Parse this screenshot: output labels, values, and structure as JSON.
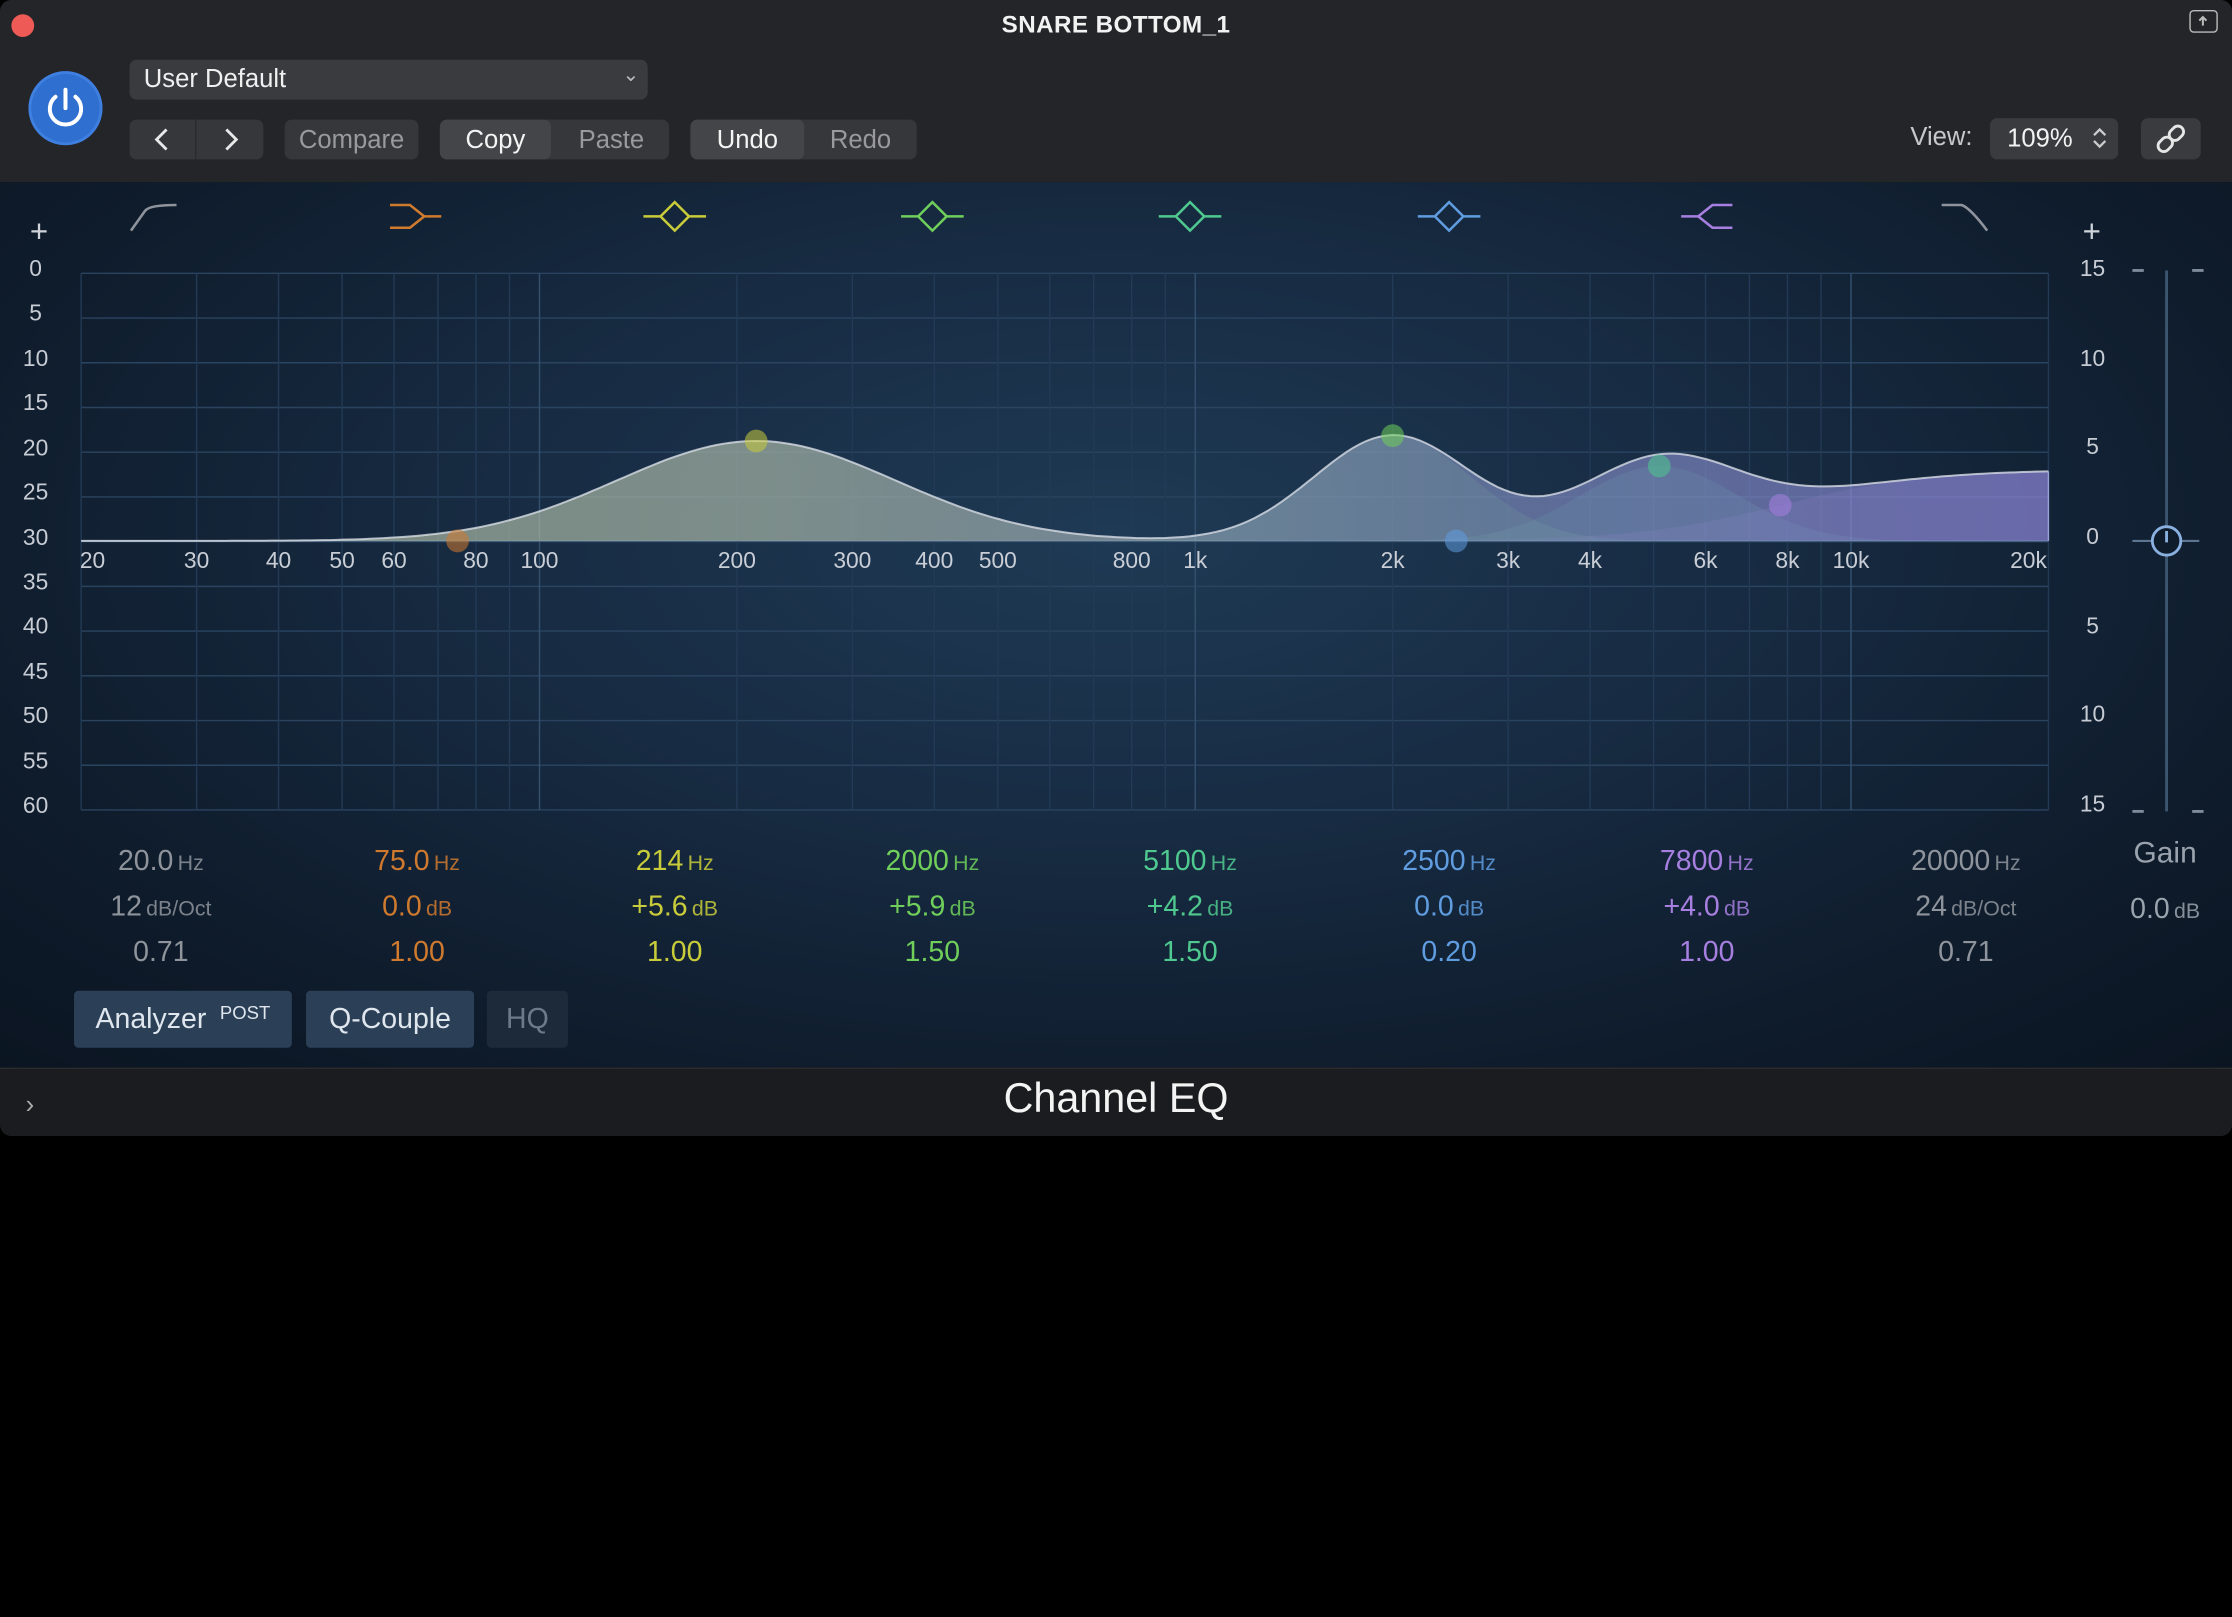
{
  "window": {
    "title": "SNARE BOTTOM_1"
  },
  "toolbar": {
    "preset": "User Default",
    "prev_label": "‹",
    "next_label": "›",
    "compare": "Compare",
    "copy": "Copy",
    "paste": "Paste",
    "undo": "Undo",
    "redo": "Redo",
    "view_label": "View:",
    "view_value": "109%"
  },
  "graph": {
    "left_scale": [
      "0",
      "5",
      "10",
      "15",
      "20",
      "25",
      "30",
      "35",
      "40",
      "45",
      "50",
      "55",
      "60"
    ],
    "right_scale": [
      "15",
      "10",
      "5",
      "0",
      "5",
      "10",
      "15"
    ],
    "freq_labels": [
      "20",
      "30",
      "40",
      "50",
      "60",
      "80",
      "100",
      "200",
      "300",
      "400",
      "500",
      "800",
      "1k",
      "2k",
      "3k",
      "4k",
      "6k",
      "8k",
      "10k",
      "20k"
    ],
    "plus_left": "+",
    "plus_right": "+"
  },
  "bands": [
    {
      "type": "low-cut",
      "color": "#8f949c",
      "freq": "20.0",
      "freq_unit": "Hz",
      "gain": "12",
      "gain_unit": "dB/Oct",
      "q": "0.71"
    },
    {
      "type": "low-shelf",
      "color": "#d07a2e",
      "freq": "75.0",
      "freq_unit": "Hz",
      "gain": "0.0",
      "gain_unit": "dB",
      "q": "1.00"
    },
    {
      "type": "bell",
      "color": "#c9cc3a",
      "freq": "214",
      "freq_unit": "Hz",
      "gain": "+5.6",
      "gain_unit": "dB",
      "q": "1.00"
    },
    {
      "type": "bell",
      "color": "#6fcf5a",
      "freq": "2000",
      "freq_unit": "Hz",
      "gain": "+5.9",
      "gain_unit": "dB",
      "q": "1.50"
    },
    {
      "type": "bell",
      "color": "#4fc98f",
      "freq": "5100",
      "freq_unit": "Hz",
      "gain": "+4.2",
      "gain_unit": "dB",
      "q": "1.50"
    },
    {
      "type": "bell",
      "color": "#5f9de0",
      "freq": "2500",
      "freq_unit": "Hz",
      "gain": "0.0",
      "gain_unit": "dB",
      "q": "0.20"
    },
    {
      "type": "high-shelf",
      "color": "#a67fe0",
      "freq": "7800",
      "freq_unit": "Hz",
      "gain": "+4.0",
      "gain_unit": "dB",
      "q": "1.00"
    },
    {
      "type": "high-cut",
      "color": "#8f949c",
      "freq": "20000",
      "freq_unit": "Hz",
      "gain": "24",
      "gain_unit": "dB/Oct",
      "q": "0.71"
    }
  ],
  "gain": {
    "label": "Gain",
    "value": "0.0",
    "unit": "dB"
  },
  "toggles": {
    "analyzer": "Analyzer",
    "analyzer_badge": "POST",
    "qcouple": "Q-Couple",
    "hq": "HQ"
  },
  "footer": {
    "plugin_name": "Channel EQ"
  }
}
